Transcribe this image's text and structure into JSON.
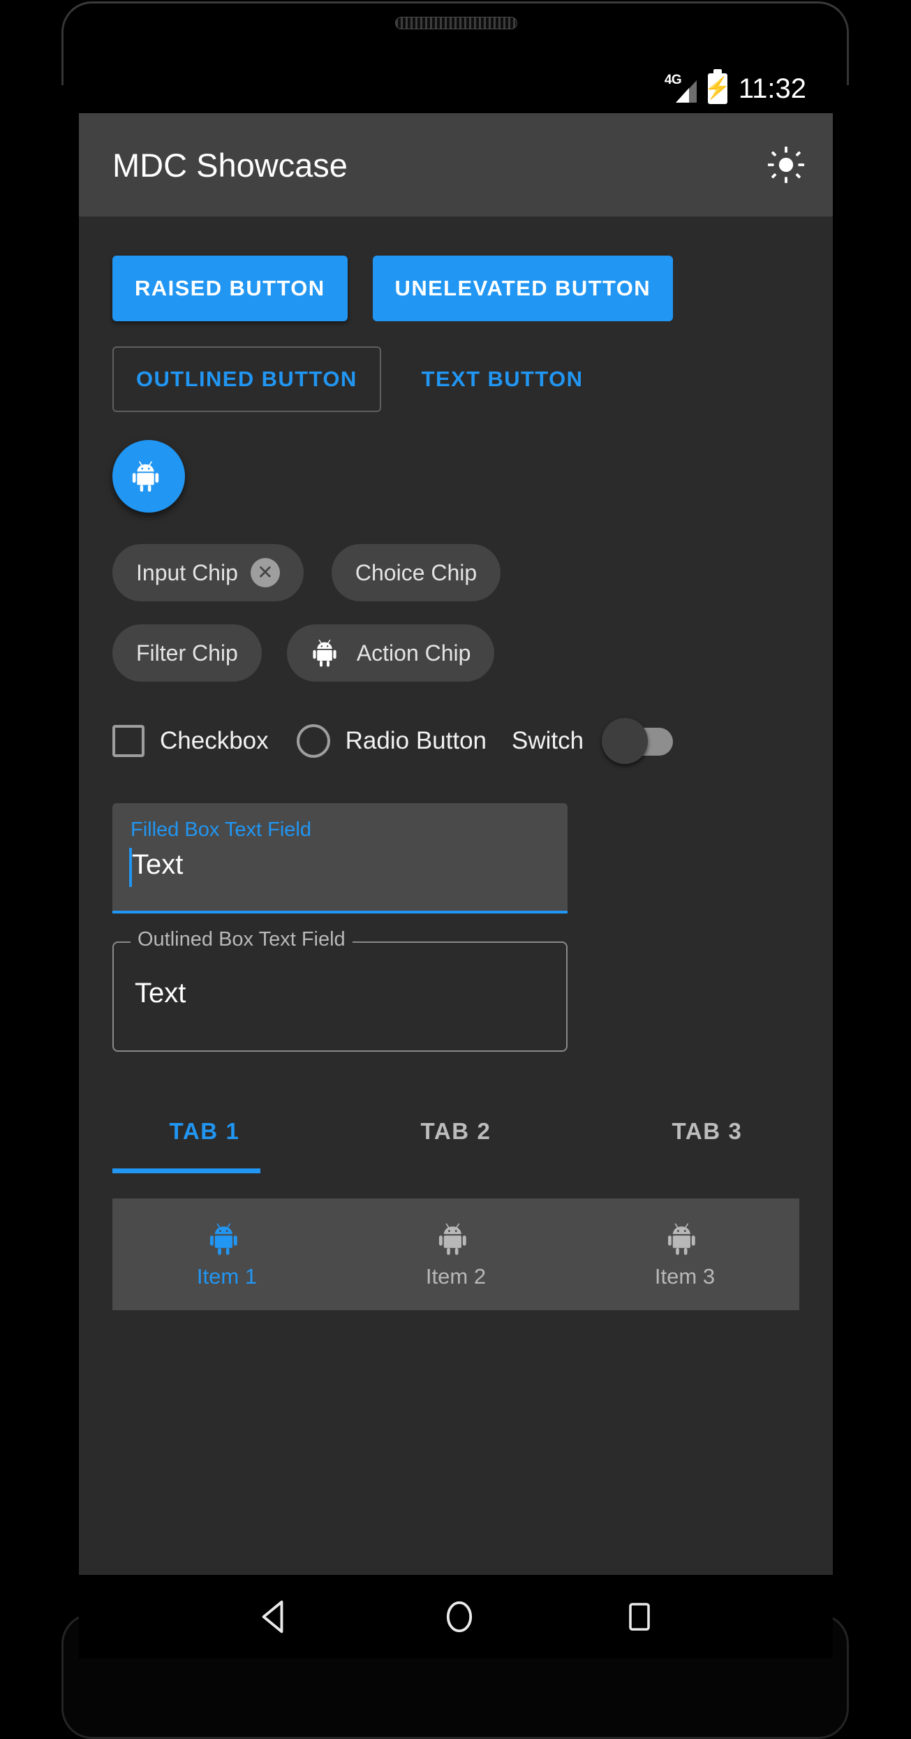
{
  "status_bar": {
    "network_label": "4G",
    "signal_icon": "signal-bars-icon",
    "battery_icon": "battery-charging-icon",
    "time": "11:32"
  },
  "app_bar": {
    "title": "MDC Showcase",
    "action_icon": "brightness-sun-icon"
  },
  "buttons": {
    "raised": "RAISED BUTTON",
    "unelevated": "UNELEVATED BUTTON",
    "outlined": "OUTLINED BUTTON",
    "text": "TEXT BUTTON"
  },
  "fab": {
    "icon": "android-robot-icon"
  },
  "chips": [
    {
      "label": "Input Chip",
      "trailing_icon": "close-circle-icon",
      "leading_icon": null
    },
    {
      "label": "Choice Chip",
      "trailing_icon": null,
      "leading_icon": null
    },
    {
      "label": "Filter Chip",
      "trailing_icon": null,
      "leading_icon": null
    },
    {
      "label": "Action Chip",
      "trailing_icon": null,
      "leading_icon": "android-robot-icon"
    }
  ],
  "controls": {
    "checkbox_label": "Checkbox",
    "checkbox_checked": false,
    "radio_label": "Radio Button",
    "radio_selected": false,
    "switch_label": "Switch",
    "switch_on": false
  },
  "text_fields": {
    "filled": {
      "label": "Filled Box Text Field",
      "value": "Text",
      "focused": true
    },
    "outlined": {
      "label": "Outlined Box Text Field",
      "value": "Text",
      "focused": false
    }
  },
  "tabs": {
    "items": [
      {
        "label": "TAB 1",
        "active": true
      },
      {
        "label": "TAB 2",
        "active": false
      },
      {
        "label": "TAB 3",
        "active": false
      }
    ]
  },
  "bottom_nav": {
    "items": [
      {
        "label": "Item 1",
        "icon": "android-robot-icon",
        "active": true
      },
      {
        "label": "Item 2",
        "icon": "android-robot-icon",
        "active": false
      },
      {
        "label": "Item 3",
        "icon": "android-robot-icon",
        "active": false
      }
    ]
  },
  "system_nav": {
    "back": "back-triangle-icon",
    "home": "home-circle-icon",
    "recents": "recents-square-icon"
  },
  "colors": {
    "accent": "#2196f3",
    "app_bar": "#424242",
    "background": "#2b2b2b",
    "chip": "#444444",
    "bottom_nav": "#4b4b4b",
    "on_surface": "#ffffff",
    "on_surface_muted": "#b8b8b8"
  }
}
